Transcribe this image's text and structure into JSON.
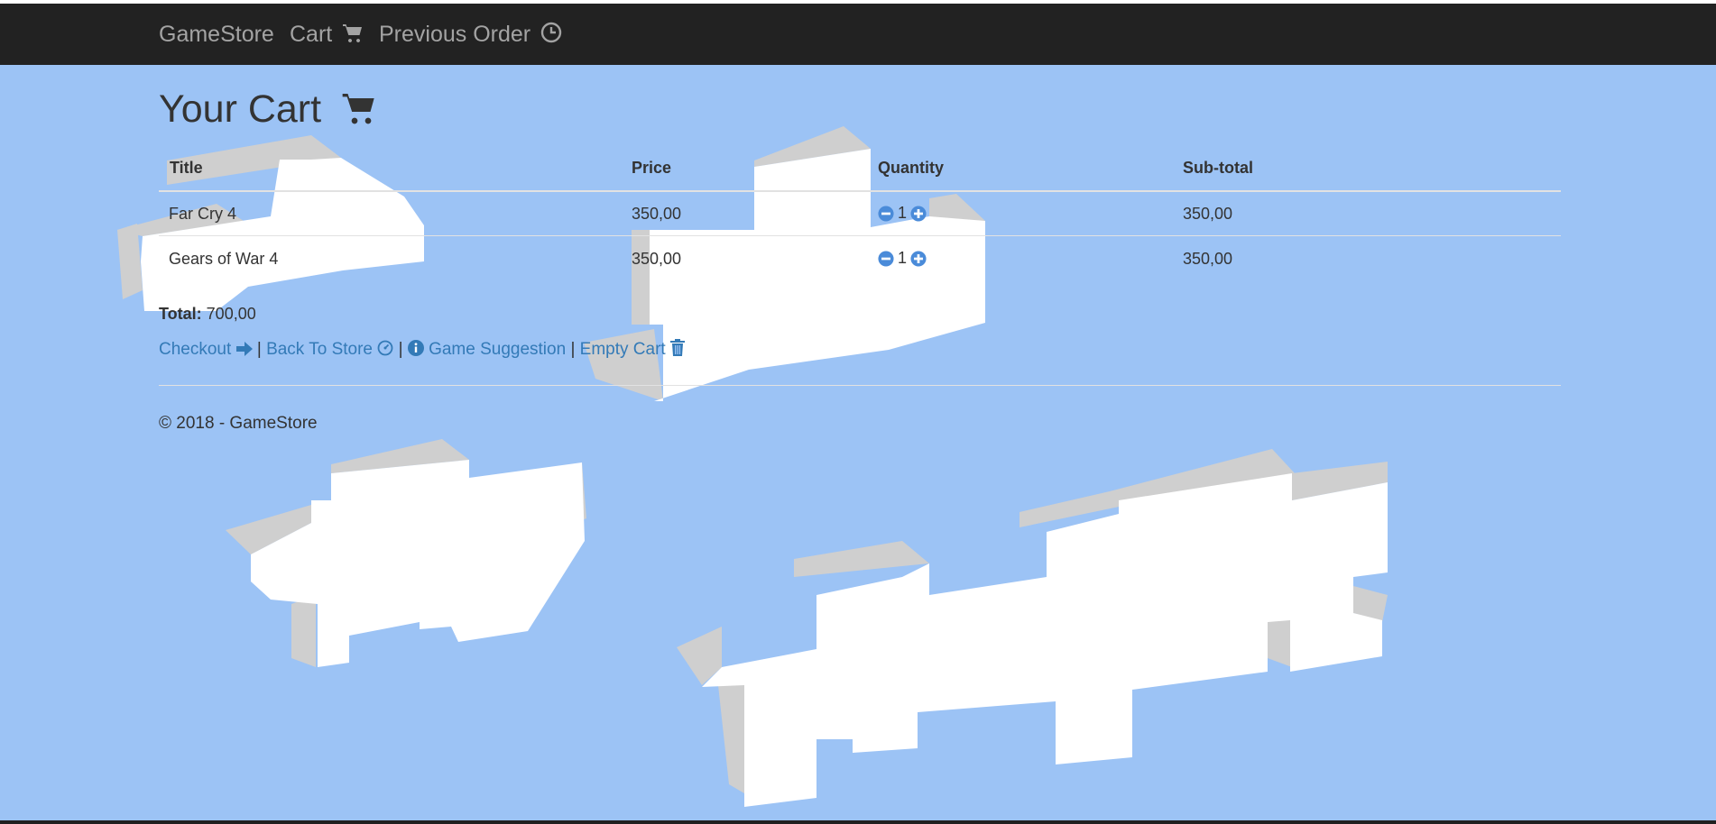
{
  "navbar": {
    "brand": "GameStore",
    "links": [
      {
        "label": "Cart",
        "icon": "cart-icon"
      },
      {
        "label": "Previous Order",
        "icon": "clock-icon"
      }
    ]
  },
  "page": {
    "title": "Your Cart",
    "title_icon": "cart-icon"
  },
  "cart": {
    "columns": [
      "Title",
      "Price",
      "Quantity",
      "Sub-total"
    ],
    "rows": [
      {
        "title": "Far Cry 4",
        "price": "350,00",
        "quantity": "1",
        "subtotal": "350,00"
      },
      {
        "title": "Gears of War 4",
        "price": "350,00",
        "quantity": "1",
        "subtotal": "350,00"
      }
    ],
    "total_label": "Total:",
    "total_value": "700,00"
  },
  "actions": {
    "checkout": "Checkout",
    "back_to_store": "Back To Store",
    "game_suggestion": "Game Suggestion",
    "empty_cart": "Empty Cart",
    "separator": "|"
  },
  "footer": {
    "copyright": "© 2018 - GameStore"
  },
  "colors": {
    "background": "#9cc3f5",
    "navbar": "#222222",
    "nav_text": "#a3a3a3",
    "link": "#337ab7",
    "quantity_button": "#4a8bd9"
  }
}
